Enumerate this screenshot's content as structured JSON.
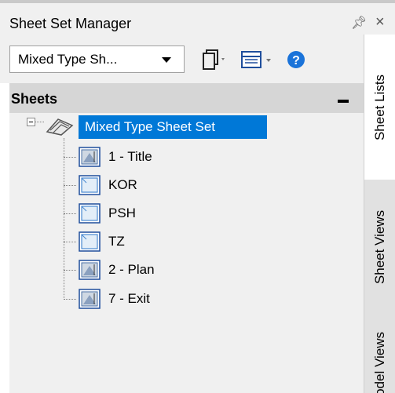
{
  "window": {
    "title": "Sheet Set Manager",
    "pin_icon": "pin-icon",
    "close_icon": "close-icon"
  },
  "toolbar": {
    "sheet_set_selector": "Mixed Type Sh...",
    "icons": [
      "sheet-selection-icon",
      "view-options-icon",
      "help-icon"
    ]
  },
  "panel": {
    "header": "Sheets"
  },
  "tree": {
    "root": {
      "label": "Mixed Type Sheet Set",
      "icon": "sheet-set-icon",
      "selected": true
    },
    "sheets": [
      {
        "label": "1 - Title",
        "icon": "layout-sheet-icon"
      },
      {
        "label": "KOR",
        "icon": "model-sheet-icon"
      },
      {
        "label": "PSH",
        "icon": "model-sheet-icon"
      },
      {
        "label": "TZ",
        "icon": "model-sheet-icon"
      },
      {
        "label": "2 - Plan",
        "icon": "layout-sheet-icon"
      },
      {
        "label": "7 - Exit",
        "icon": "layout-sheet-icon"
      }
    ]
  },
  "tabs": [
    {
      "label": "Sheet Lists",
      "active": true
    },
    {
      "label": "Sheet Views",
      "active": false
    },
    {
      "label": "Model Views",
      "active": false
    }
  ],
  "colors": {
    "selection": "#0078d7",
    "panel_bg": "#f0f0f0",
    "header_bg": "#d6d6d6",
    "help": "#1a73d9"
  }
}
